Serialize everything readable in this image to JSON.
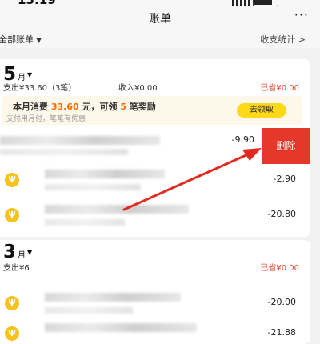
{
  "status": {
    "time": "15:19",
    "battery_level": 0.8
  },
  "header": {
    "title": "账单",
    "more_label": "···"
  },
  "filter": {
    "all_bills": "全部账单",
    "stats": "收支统计 >"
  },
  "month_groups": [
    {
      "month": "5",
      "month_unit": "月",
      "spend": "支出¥33.60（3笔）",
      "income": "收入¥0.00",
      "saved": "已省¥0.00",
      "promo": {
        "prefix": "本月消费 ",
        "amount": "33.60",
        "middle": " 元，可领 ",
        "count": "5",
        "suffix": " 笔奖励",
        "subtitle": "支付用月付，笔笔有优惠",
        "button": "去领取"
      },
      "transactions": [
        {
          "amount": "-9.90",
          "swiped": true
        },
        {
          "amount": "-2.90"
        },
        {
          "amount": "-20.80"
        }
      ],
      "delete_label": "删除"
    },
    {
      "month": "3",
      "month_unit": "月",
      "spend": "支出¥6",
      "saved": "已省¥0.00",
      "transactions": [
        {
          "amount": "-20.00"
        },
        {
          "amount": "-21.88"
        }
      ]
    }
  ],
  "colors": {
    "accent_red": "#e5372a",
    "saved_red": "#e5492f",
    "promo_orange": "#ff6a00",
    "button_yellow": "#ffd81a",
    "icon_yellow": "#f7c21d"
  },
  "icons": {
    "category": "fork-knife-icon"
  }
}
